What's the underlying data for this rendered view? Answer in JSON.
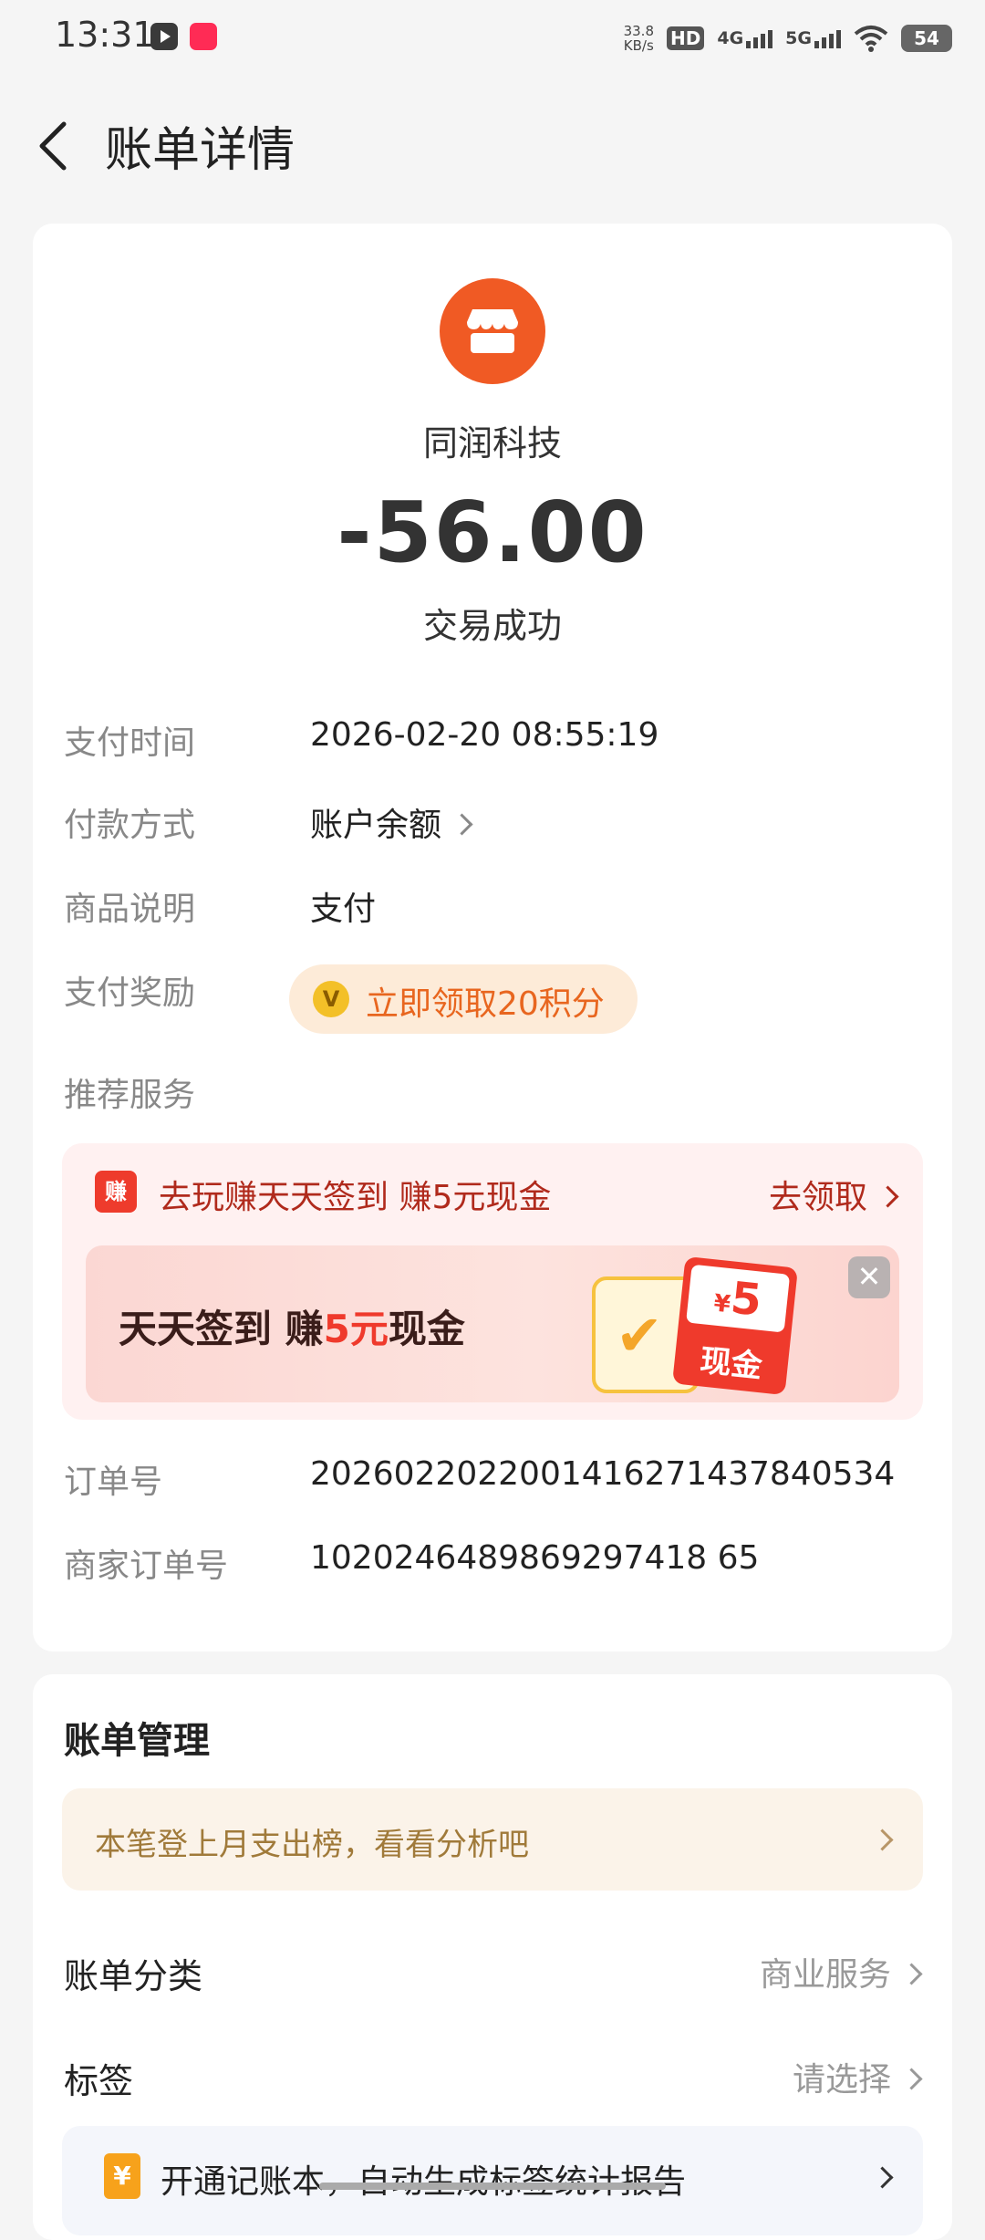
{
  "status_bar": {
    "time": "13:31",
    "net_speed_value": "33.8",
    "net_speed_unit": "KB/s",
    "hd": "HD",
    "net1": "4G",
    "net2": "5G",
    "battery": "54"
  },
  "header": {
    "title": "账单详情"
  },
  "transaction": {
    "merchant": "同润科技",
    "amount": "-56.00",
    "status": "交易成功"
  },
  "details": {
    "pay_time_label": "支付时间",
    "pay_time": "2026-02-20 08:55:19",
    "pay_method_label": "付款方式",
    "pay_method": "账户余额",
    "product_label": "商品说明",
    "product": "支付",
    "reward_label": "支付奖励",
    "reward_text": "立即领取20积分",
    "recommend_label": "推荐服务",
    "order_no_label": "订单号",
    "order_no": "2026022022001416271437840534",
    "merchant_order_label": "商家订单号",
    "merchant_order": "1020246489869297418 65"
  },
  "promo": {
    "icon_text": "赚",
    "title": "去玩赚天天签到 赚5元现金",
    "action": "去领取",
    "banner_prefix": "天天签到 赚",
    "banner_highlight": "5元",
    "banner_suffix": "现金",
    "cash_currency": "¥",
    "cash_amount": "5",
    "cash_label": "现金"
  },
  "management": {
    "title": "账单管理",
    "analysis_text": "本笔登上月支出榜，看看分析吧",
    "category_label": "账单分类",
    "category_value": "商业服务",
    "tag_label": "标签",
    "tag_value": "请选择",
    "notebook_icon": "¥",
    "notebook_text": "开通记账本，自动生成标签统计报告"
  },
  "colors": {
    "accent": "#f05a24",
    "promo_red": "#ef3a2c",
    "reward_orange": "#e8661f",
    "background": "#f5f5f5"
  }
}
